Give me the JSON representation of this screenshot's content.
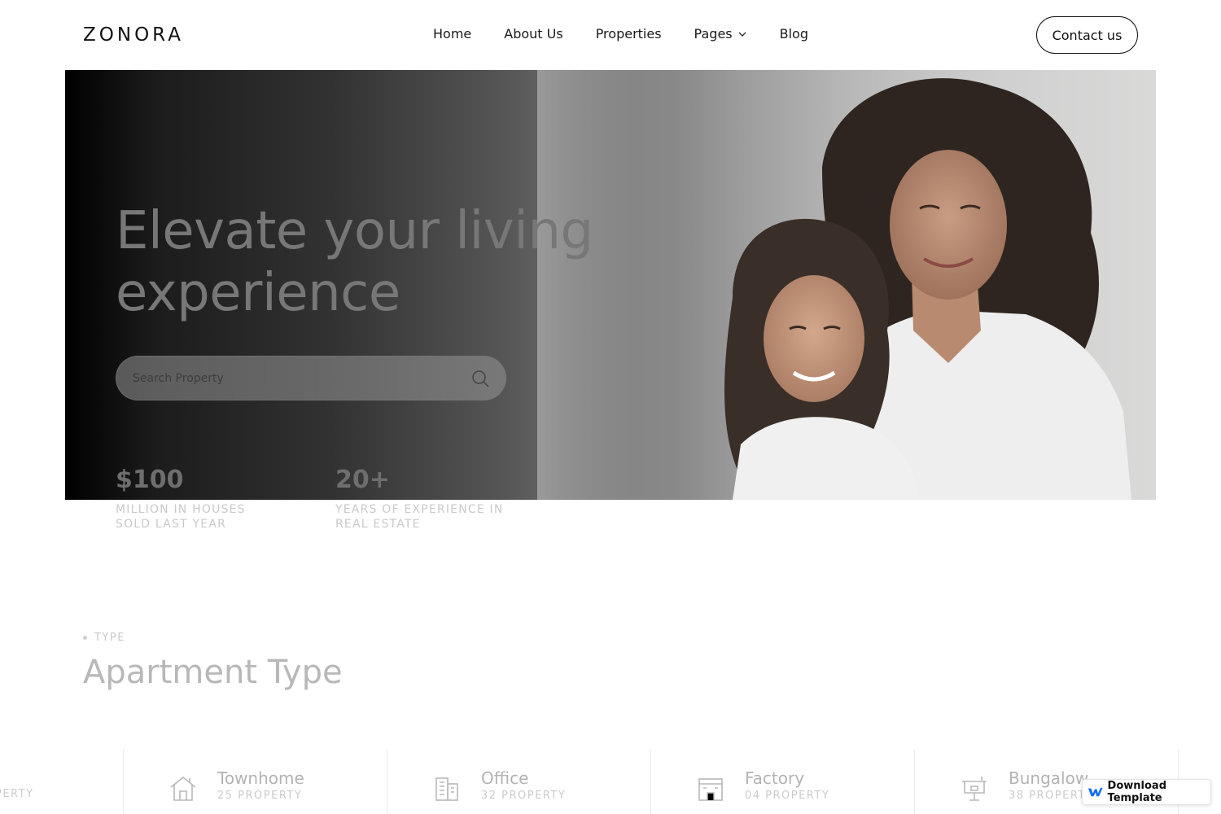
{
  "header": {
    "logo": "ZONORA",
    "nav": [
      {
        "label": "Home"
      },
      {
        "label": "About Us"
      },
      {
        "label": "Properties"
      },
      {
        "label": "Pages",
        "icon": "chevron-down-icon"
      },
      {
        "label": "Blog"
      }
    ],
    "contact_label": "Contact us"
  },
  "hero": {
    "title_line1": "Elevate your living",
    "title_line2": "experience",
    "search": {
      "placeholder": "Search Property",
      "icon": "search-icon"
    },
    "stats": [
      {
        "value": "$100",
        "label_line1": "MILLION IN HOUSES",
        "label_line2": "SOLD LAST YEAR"
      },
      {
        "value": "20+",
        "label_line1": "YEARS OF EXPERIENCE IN",
        "label_line2": "REAL ESTATE"
      }
    ]
  },
  "types_section": {
    "tag": "TYPE",
    "title": "Apartment Type",
    "partial_item_count": "PERTY",
    "items": [
      {
        "name": "Townhome",
        "count": "25 PROPERTY",
        "icon": "house-icon"
      },
      {
        "name": "Office",
        "count": "32 PROPERTY",
        "icon": "office-building-icon"
      },
      {
        "name": "Factory",
        "count": "04 PROPERTY",
        "icon": "factory-icon"
      },
      {
        "name": "Bungalow",
        "count": "38 PROPERTY",
        "icon": "bungalow-icon"
      }
    ]
  },
  "badge": {
    "label": "Download Template",
    "icon": "webflow-icon"
  },
  "colors": {
    "accent": "#111111",
    "muted_text": "#b3b3b3",
    "webflow_blue": "#146ef5"
  }
}
